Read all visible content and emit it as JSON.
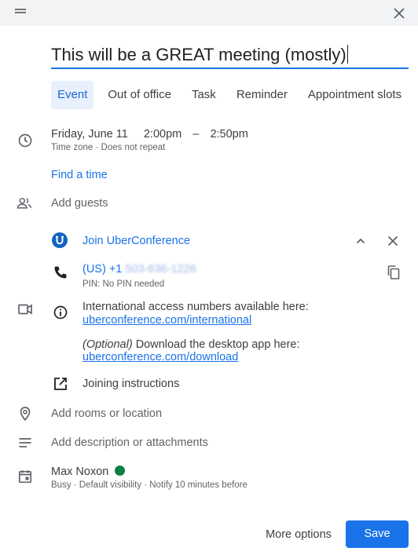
{
  "event": {
    "title": "This will be a GREAT meeting (mostly)"
  },
  "tabs": [
    {
      "label": "Event",
      "active": true
    },
    {
      "label": "Out of office"
    },
    {
      "label": "Task"
    },
    {
      "label": "Reminder"
    },
    {
      "label": "Appointment slots"
    }
  ],
  "datetime": {
    "date": "Friday, June 11",
    "start": "2:00pm",
    "dash": "–",
    "end": "2:50pm",
    "timezone": "Time zone",
    "separator": "·",
    "repeat": "Does not repeat",
    "find_time": "Find a time"
  },
  "guests": {
    "placeholder": "Add guests"
  },
  "conference": {
    "join_label": "Join UberConference",
    "phone_prefix": "(US) +1",
    "phone_blurred": "503-636-1226",
    "pin": "PIN: No PIN needed",
    "intl_text": "International access numbers available here:",
    "intl_link": "uberconference.com/international",
    "optional": "(Optional)",
    "download_text": "Download the desktop app here:",
    "download_link": "uberconference.com/download",
    "joining": "Joining instructions"
  },
  "location": {
    "placeholder": "Add rooms or location"
  },
  "description": {
    "placeholder": "Add description or attachments"
  },
  "owner": {
    "name": "Max Noxon",
    "status": "Busy · Default visibility · Notify 10 minutes before",
    "color": "#0b8043"
  },
  "actions": {
    "more": "More options",
    "save": "Save"
  },
  "colors": {
    "accent": "#1a73e8",
    "tab_active_bg": "#e8f0fe",
    "uberconference_brand": "#1565c0"
  }
}
